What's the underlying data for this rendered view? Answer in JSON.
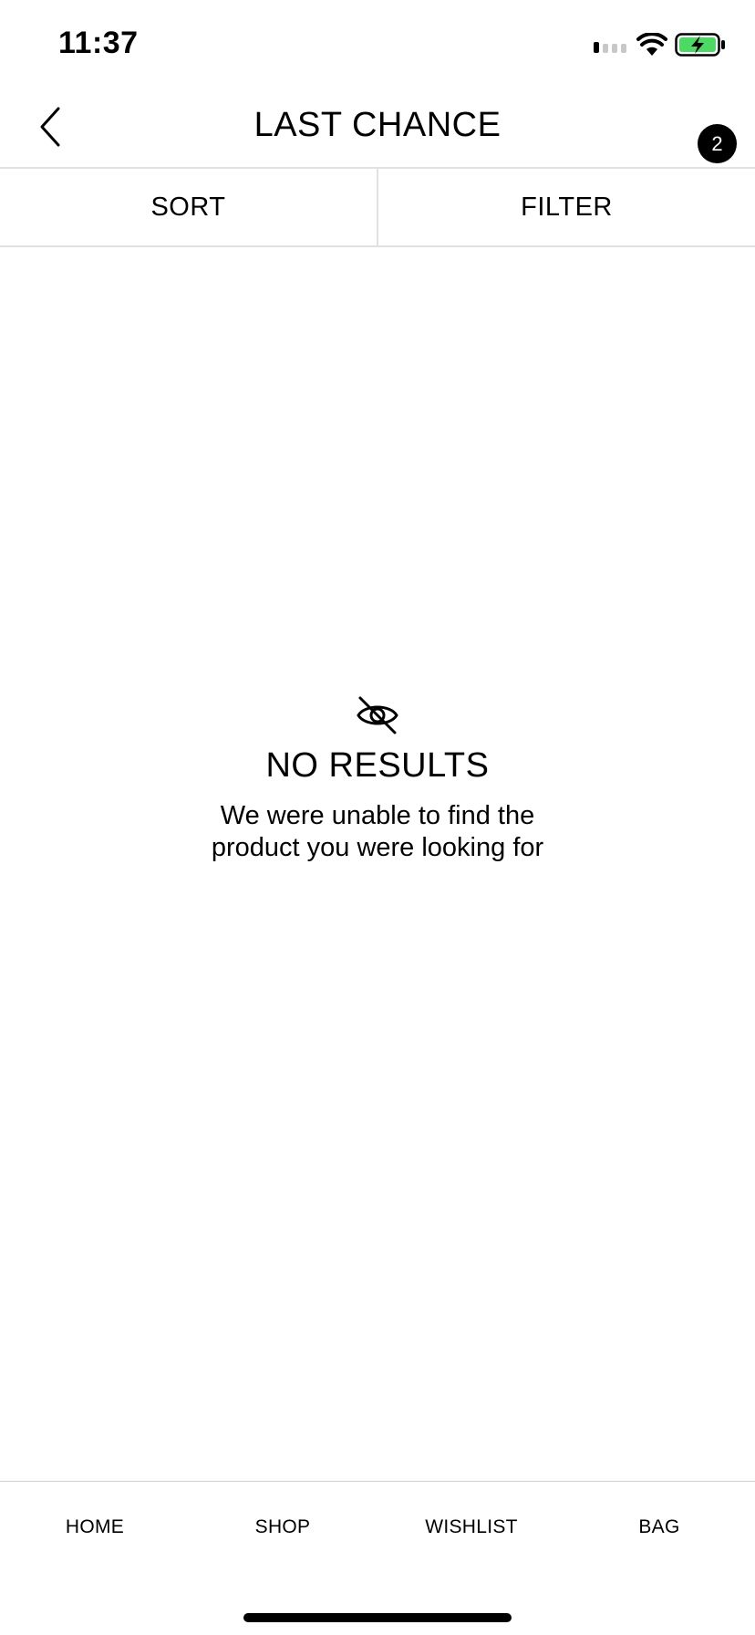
{
  "status_bar": {
    "time": "11:37",
    "icons": [
      "signal-icon",
      "wifi-icon",
      "battery-charging-icon"
    ],
    "battery_color": "#4cd964"
  },
  "header": {
    "back_icon": "chevron-left-icon",
    "title": "LAST CHANCE",
    "badge_count": "2"
  },
  "toolbar": {
    "sort_label": "SORT",
    "filter_label": "FILTER"
  },
  "empty_state": {
    "icon": "eye-slash-icon",
    "title": "NO RESULTS",
    "message": "We were unable to find the product you were looking for"
  },
  "bottom_nav": {
    "items": [
      {
        "label": "HOME"
      },
      {
        "label": "SHOP"
      },
      {
        "label": "WISHLIST"
      },
      {
        "label": "BAG"
      }
    ]
  },
  "colors": {
    "text": "#000000",
    "divider": "#e1e1e1",
    "background": "#ffffff"
  }
}
